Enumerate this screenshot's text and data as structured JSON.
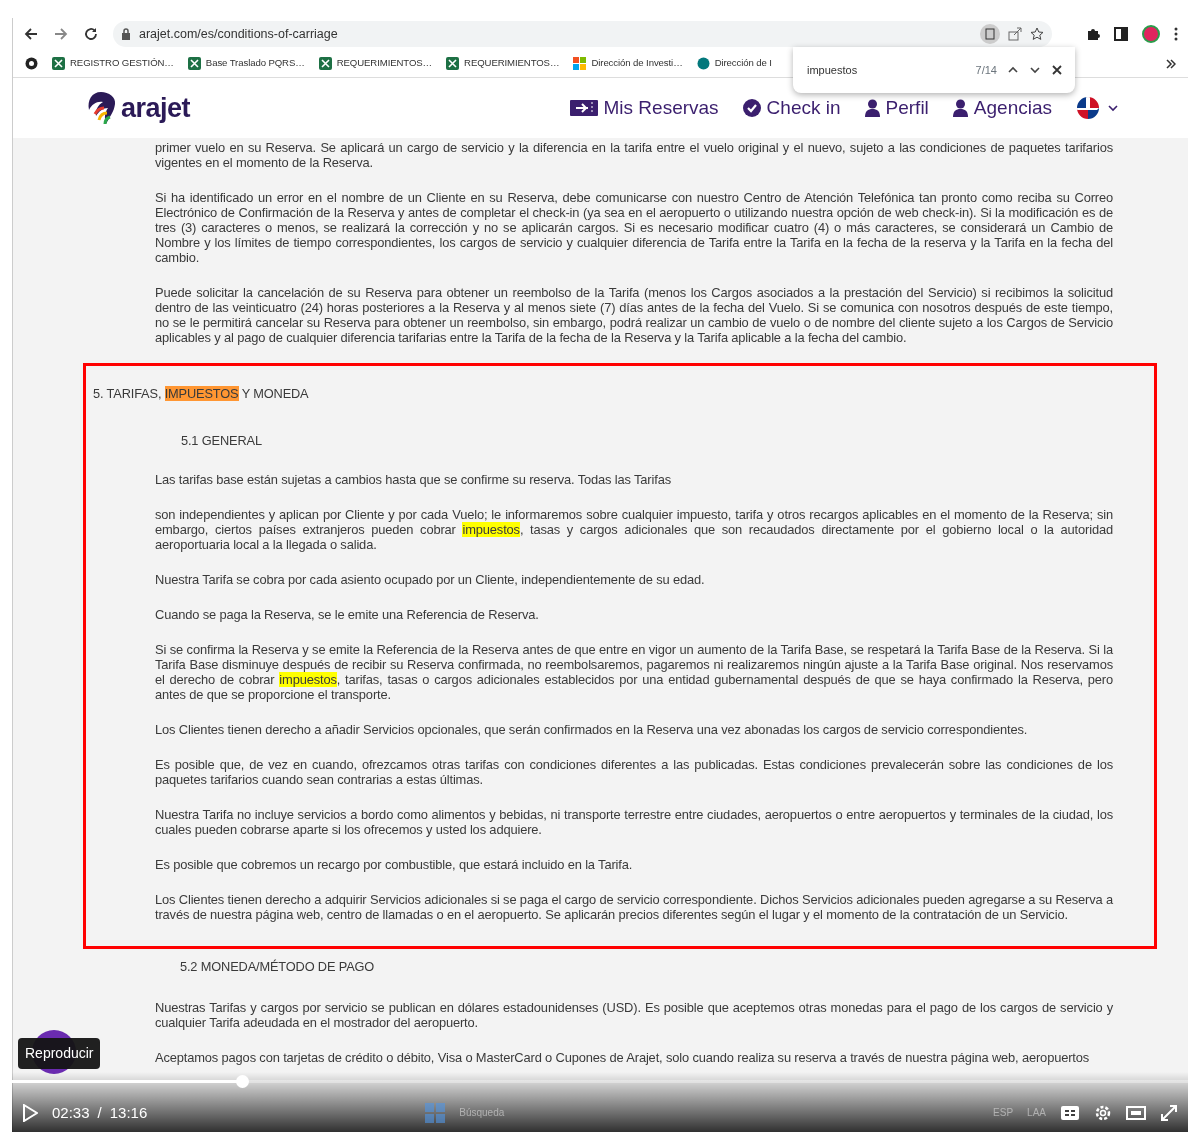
{
  "browser": {
    "url": "arajet.com/es/conditions-of-carriage",
    "bookmarks": [
      {
        "label": "REGISTRO GESTIÓN…",
        "kind": "sheet"
      },
      {
        "label": "Base Traslado PQRS…",
        "kind": "sheet"
      },
      {
        "label": "REQUERIMIENTOS…",
        "kind": "sheet"
      },
      {
        "label": "REQUERIMIENTOS…",
        "kind": "sheet"
      },
      {
        "label": "Dirección de Investi…",
        "kind": "grid"
      },
      {
        "label": "Dirección de I",
        "kind": "site"
      }
    ]
  },
  "find_bar": {
    "query": "impuestos",
    "count": "7/14"
  },
  "site": {
    "logo": "arajet",
    "nav": [
      {
        "label": "Mis Reservas",
        "kind": "reservations"
      },
      {
        "label": "Check in",
        "kind": "checkin"
      },
      {
        "label": "Perfil",
        "kind": "profile"
      },
      {
        "label": "Agencias",
        "kind": "profile"
      }
    ]
  },
  "document": {
    "before": [
      {
        "kind": "paragraph",
        "parts": [
          {
            "text": "primer vuelo en su Reserva. Se aplicará un cargo de servicio y la diferencia en la tarifa entre el vuelo original y el nuevo, sujeto a las condiciones de paquetes tarifarios vigentes en el momento de la Reserva."
          }
        ]
      },
      {
        "kind": "paragraph",
        "parts": [
          {
            "text": "Si ha identificado un error en el nombre de un Cliente en su Reserva, debe comunicarse con nuestro Centro de Atención Telefónica tan pronto como reciba su Correo Electrónico de Confirmación de la Reserva y antes de completar el check-in (ya sea en el aeropuerto o utilizando nuestra opción de web check-in). Si la modificación es de tres (3) caracteres o menos, se realizará la corrección y no se aplicarán cargos. Si es necesario modificar cuatro (4) o más caracteres, se considerará un Cambio de Nombre y los límites de tiempo correspondientes, los cargos de servicio y cualquier diferencia de Tarifa entre la Tarifa en la fecha de la reserva y la Tarifa en la fecha del cambio."
          }
        ]
      },
      {
        "kind": "paragraph",
        "parts": [
          {
            "text": "Puede solicitar la cancelación de su Reserva para obtener un reembolso de la Tarifa (menos los Cargos asociados a la prestación del Servicio) si recibimos la solicitud dentro de las veinticuatro (24) horas posteriores a la Reserva y al menos siete (7) días antes de la fecha del Vuelo. Si se comunica con nosotros después de este tiempo, no se le permitirá cancelar su Reserva para obtener un reembolso, sin embargo, podrá realizar un cambio de vuelo o de nombre del cliente sujeto a los Cargos de Servicio aplicables y al pago de cualquier diferencia tarifarias entre la Tarifa de la fecha de la Reserva y la Tarifa aplicable a la fecha del cambio."
          }
        ]
      }
    ],
    "framed": [
      {
        "kind": "heading",
        "parts": [
          {
            "text": "5. TARIFAS, "
          },
          {
            "text": "IMPUESTOS",
            "color": "#ff9632"
          },
          {
            "text": " Y MONEDA"
          }
        ]
      },
      {
        "kind": "subheading",
        "parts": [
          {
            "text": "5.1 GENERAL"
          }
        ]
      },
      {
        "kind": "paragraph",
        "parts": [
          {
            "text": "Las tarifas base están sujetas a cambios hasta que se confirme su reserva. Todas las Tarifas"
          }
        ]
      },
      {
        "kind": "paragraph",
        "parts": [
          {
            "text": "son independientes y aplican por Cliente y por cada Vuelo; le informaremos sobre cualquier impuesto, tarifa y otros recargos aplicables en el momento de la Reserva; sin embargo, ciertos países extranjeros pueden cobrar "
          },
          {
            "text": "impuestos",
            "color": "#ffff00"
          },
          {
            "text": ", tasas y cargos adicionales que son recaudados directamente por el gobierno local o la autoridad aeroportuaria local a la llegada o salida."
          }
        ]
      },
      {
        "kind": "paragraph",
        "parts": [
          {
            "text": "Nuestra Tarifa se cobra por cada asiento ocupado por un Cliente, independientemente de su edad."
          }
        ]
      },
      {
        "kind": "paragraph",
        "parts": [
          {
            "text": "Cuando se paga la Reserva, se le emite una Referencia de Reserva."
          }
        ]
      },
      {
        "kind": "paragraph",
        "parts": [
          {
            "text": "Si se confirma la Reserva y se emite la Referencia de la Reserva antes de que entre en vigor un aumento de la Tarifa Base, se respetará la Tarifa Base de la Reserva. Si la Tarifa Base disminuye después de recibir su Reserva confirmada, no reembolsaremos, pagaremos ni realizaremos ningún ajuste a la Tarifa Base original. Nos reservamos el derecho de cobrar "
          },
          {
            "text": "impuestos",
            "color": "#ffff00"
          },
          {
            "text": ", tarifas, tasas o cargos adicionales establecidos por una entidad gubernamental después de que se haya confirmado la Reserva, pero antes de que se proporcione el transporte."
          }
        ]
      },
      {
        "kind": "paragraph",
        "parts": [
          {
            "text": "Los Clientes tienen derecho a añadir Servicios opcionales, que serán confirmados en la Reserva una vez abonadas los cargos de servicio correspondientes."
          }
        ]
      },
      {
        "kind": "paragraph",
        "parts": [
          {
            "text": "Es posible que, de vez en cuando, ofrezcamos otras tarifas con condiciones diferentes a las publicadas. Estas condiciones prevalecerán sobre las condiciones de los paquetes tarifarios cuando sean contrarias a estas últimas."
          }
        ]
      },
      {
        "kind": "paragraph",
        "parts": [
          {
            "text": "Nuestra Tarifa no incluye servicios a bordo como alimentos y bebidas, ni transporte terrestre entre ciudades, aeropuertos o entre aeropuertos y terminales de la ciudad, los cuales pueden cobrarse aparte si los ofrecemos y usted los adquiere."
          }
        ]
      },
      {
        "kind": "paragraph",
        "parts": [
          {
            "text": "Es posible que cobremos un recargo por combustible, que estará incluido en la Tarifa."
          }
        ]
      },
      {
        "kind": "paragraph",
        "parts": [
          {
            "text": "Los Clientes tienen derecho a adquirir Servicios adicionales si se paga el cargo de servicio correspondiente. Dichos Servicios adicionales pueden agregarse a su Reserva a través de nuestra página web, centro de llamadas o en el aeropuerto. Se aplicarán precios diferentes según el lugar y el momento de la contratación de un Servicio."
          }
        ]
      }
    ],
    "after": [
      {
        "kind": "subheading",
        "parts": [
          {
            "text": "5.2 MONEDA/MÉTODO DE PAGO"
          }
        ]
      },
      {
        "kind": "paragraph",
        "parts": [
          {
            "text": "Nuestras Tarifas y cargos por servicio se publican en dólares estadounidenses (USD). Es posible que aceptemos otras monedas para el pago de los cargos de servicio y cualquier Tarifa adeudada en el mostrador del aeropuerto."
          }
        ]
      },
      {
        "kind": "paragraph",
        "parts": [
          {
            "text": "Aceptamos pagos con tarjetas de crédito o débito, Visa o MasterCard o Cupones de Arajet, solo cuando realiza su reserva a través de nuestra página web, aeropuertos"
          }
        ]
      }
    ]
  },
  "taskbar": {
    "search": "Búsqueda",
    "language": "ESP",
    "layout": "LAA"
  },
  "video": {
    "tooltip": "Reproducir",
    "current_time": "02:33",
    "time_separator": "/",
    "duration": "13:16",
    "level": 0.196
  }
}
